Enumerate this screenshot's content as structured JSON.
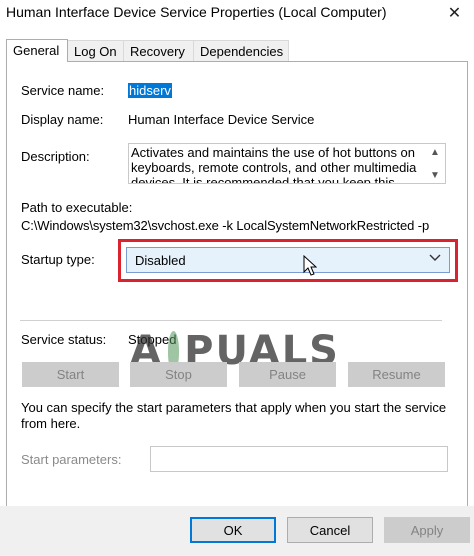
{
  "window": {
    "title": "Human Interface Device Service Properties (Local Computer)",
    "close_glyph": "✕"
  },
  "tabs": [
    {
      "label": "General",
      "active": true
    },
    {
      "label": "Log On"
    },
    {
      "label": "Recovery"
    },
    {
      "label": "Dependencies"
    }
  ],
  "general": {
    "service_name_label": "Service name:",
    "service_name_value": "hidserv",
    "display_name_label": "Display name:",
    "display_name_value": "Human Interface Device Service",
    "description_label": "Description:",
    "description_value": "Activates and maintains the use of hot buttons on keyboards, remote controls, and other multimedia devices. It is recommended that you keep this",
    "path_label": "Path to executable:",
    "path_value": "C:\\Windows\\system32\\svchost.exe -k LocalSystemNetworkRestricted -p",
    "startup_type_label": "Startup type:",
    "startup_type_value": "Disabled",
    "service_status_label": "Service status:",
    "service_status_value": "Stopped",
    "buttons": {
      "start": "Start",
      "stop": "Stop",
      "pause": "Pause",
      "resume": "Resume"
    },
    "start_params_note": "You can specify the start parameters that apply when you start the service from here.",
    "start_params_label": "Start parameters:",
    "start_params_value": ""
  },
  "footer": {
    "ok": "OK",
    "cancel": "Cancel",
    "apply": "Apply"
  },
  "watermark": {
    "text_left": "A",
    "text_right": "PUALS"
  },
  "colors": {
    "highlight": "#d9232e",
    "selection": "#0078d7",
    "combo_bg": "#e5f1fb"
  }
}
